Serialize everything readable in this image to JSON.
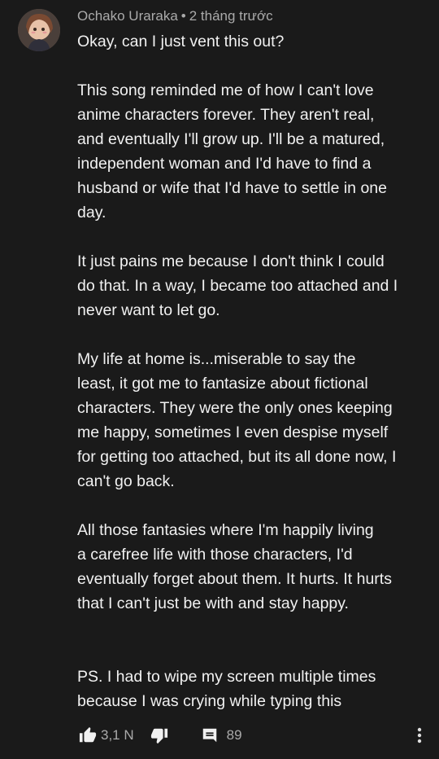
{
  "comment": {
    "author": "Ochako Uraraka",
    "separator": "•",
    "time": "2 tháng trước",
    "paragraphs": [
      [
        "Okay, can I just vent this out?"
      ],
      [
        "This song reminded me of how I can't love",
        "anime characters forever. They aren't real,",
        "and eventually I'll grow up. I'll be a matured,",
        "independent woman and I'd have to find a",
        "husband or wife that I'd have to settle in one",
        "day."
      ],
      [
        "It just pains me because I don't think I could",
        "do that. In a way, I became too attached and I",
        "never want to let go."
      ],
      [
        "My life at home is...miserable to say the",
        "least, it got me to fantasize about fictional",
        "characters. They were the only ones keeping",
        "me happy, sometimes I even despise myself",
        "for getting too attached, but its all done now, I",
        "can't go back."
      ],
      [
        "All those fantasies where I'm happily living",
        "a carefree life with those characters, I'd",
        "eventually forget about them. It hurts. It hurts",
        "that I can't just be with and stay happy."
      ],
      [
        "PS. I had to wipe my screen multiple times",
        "because I was crying while typing this"
      ]
    ],
    "like_count": "3,1 N",
    "reply_count": "89"
  },
  "icons": {
    "like": "thumbs-up-icon",
    "dislike": "thumbs-down-icon",
    "reply": "reply-comment-icon",
    "more": "more-vertical-icon"
  }
}
